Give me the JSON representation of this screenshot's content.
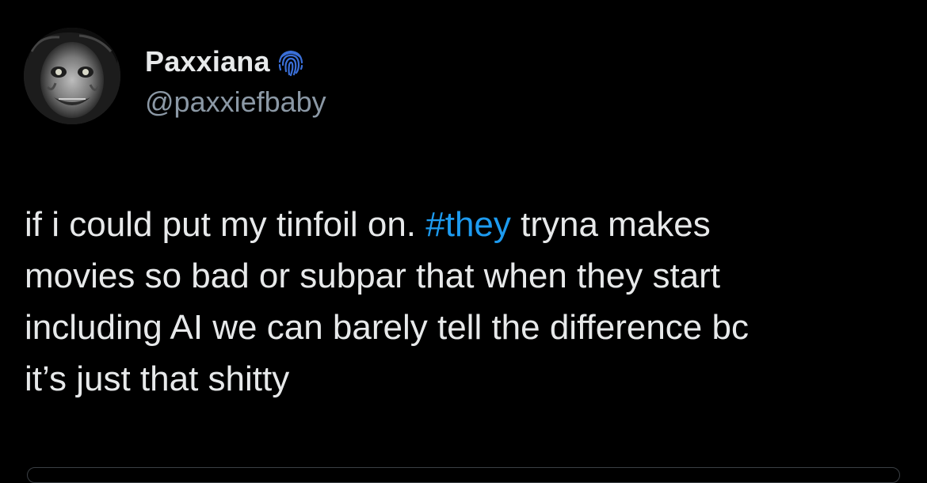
{
  "author": {
    "display_name": "Paxxiana",
    "handle": "@paxxiefbaby",
    "badge_icon": "fingerprint-icon",
    "badge_color": "#3a6fd8",
    "avatar_icon": "profile-photo"
  },
  "tweet": {
    "line1_before": "if i could put my tinfoil on. ",
    "hashtag": "#they",
    "line1_after": " tryna makes",
    "line2": "movies so bad or subpar that when they start",
    "line3": "including AI we can barely tell the difference bc",
    "line4": "it’s just that shitty"
  },
  "colors": {
    "background": "#000000",
    "text": "#e7e9ea",
    "secondary_text": "#8b98a5",
    "link": "#1d9bf0"
  }
}
